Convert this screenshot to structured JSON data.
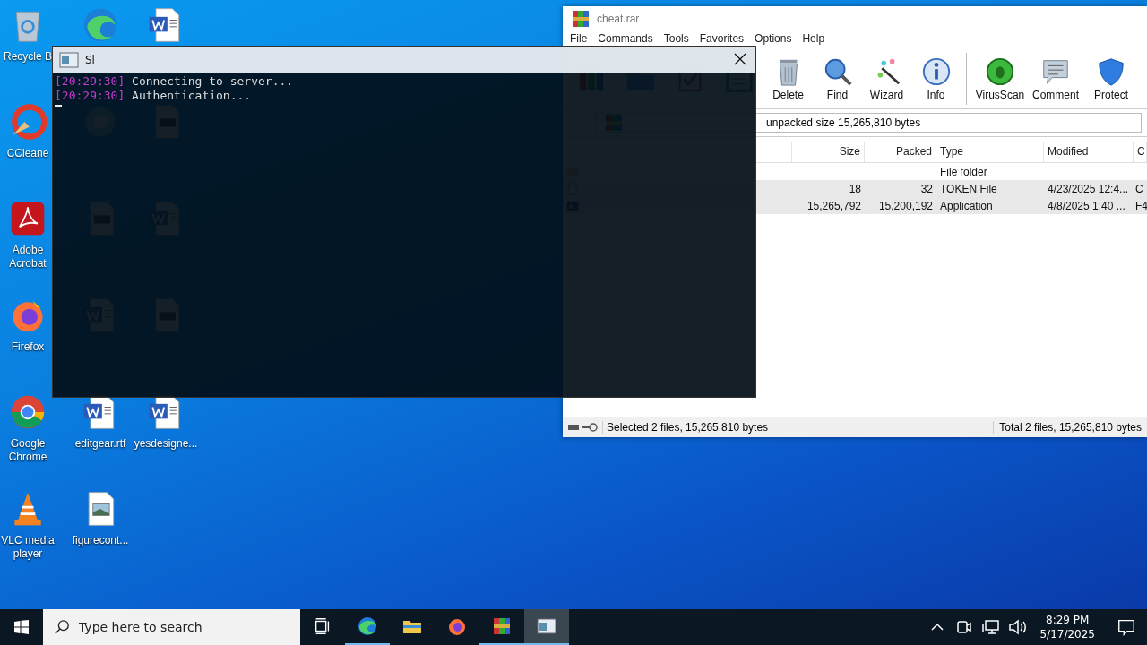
{
  "desktop": {
    "columns": [
      [
        {
          "kind": "recycle",
          "label": "Recycle B"
        },
        {
          "kind": "ccleaner",
          "label": "CCleane"
        },
        {
          "kind": "acrobat",
          "label": "Adobe Acrobat"
        },
        {
          "kind": "firefox",
          "label": "Firefox"
        },
        {
          "kind": "chrome",
          "label": "Google Chrome"
        },
        {
          "kind": "vlc",
          "label": "VLC media player"
        }
      ],
      [
        {
          "kind": "edge"
        },
        {
          "kind": "skype"
        },
        {
          "kind": "document"
        },
        {
          "kind": "word"
        },
        {
          "kind": "word",
          "label": "editgear.rtf"
        },
        {
          "kind": "image",
          "label": "figurecont..."
        }
      ],
      [
        {
          "kind": "word"
        },
        {
          "kind": "document"
        },
        {
          "kind": "word"
        },
        {
          "kind": "document"
        },
        {
          "kind": "word",
          "label": "yesdesigne..."
        }
      ]
    ]
  },
  "winrar": {
    "title": "cheat.rar",
    "menu": [
      "File",
      "Commands",
      "Tools",
      "Favorites",
      "Options",
      "Help"
    ],
    "toolbar": {
      "groups": [
        [
          {
            "kind": "add"
          },
          {
            "kind": "extract"
          },
          {
            "kind": "test"
          },
          {
            "kind": "view"
          },
          {
            "kind": "delete",
            "label": "Delete"
          },
          {
            "kind": "find",
            "label": "Find"
          },
          {
            "kind": "wizard",
            "label": "Wizard"
          },
          {
            "kind": "info",
            "label": "Info"
          }
        ],
        [
          {
            "kind": "virusscan",
            "label": "VirusScan"
          },
          {
            "kind": "comment",
            "label": "Comment"
          },
          {
            "kind": "protect",
            "label": "Protect"
          }
        ]
      ]
    },
    "address": "unpacked size 15,265,810 bytes",
    "columns": [
      "Size",
      "Packed",
      "Type",
      "Modified",
      "C"
    ],
    "files": [
      {
        "kind": "folder",
        "type": "File folder",
        "selected": false
      },
      {
        "kind": "file",
        "size": "18",
        "packed": "32",
        "type": "TOKEN File",
        "modified": "4/23/2025 12:4...",
        "column_6": "C",
        "selected": true
      },
      {
        "kind": "exe",
        "size": "15,265,792",
        "packed": "15,200,192",
        "type": "Application",
        "modified": "4/8/2025 1:40 ...",
        "column_6": "F4",
        "selected": true
      }
    ],
    "status_bar": {
      "selected": "Selected 2 files, 15,265,810 bytes",
      "total": "Total 2 files, 15,265,810 bytes"
    }
  },
  "console": {
    "title": "Sl",
    "lines": [
      {
        "time": "[20:29:30]",
        "text": "Connecting to server..."
      },
      {
        "time": "[20:29:30]",
        "text": "Authentication..."
      }
    ]
  },
  "taskbar": {
    "search": {
      "placeholder": "Type here to search"
    },
    "apps": [
      {
        "kind": "edge",
        "running": true,
        "selected": false
      },
      {
        "kind": "explorer",
        "running": false,
        "selected": false
      },
      {
        "kind": "firefox",
        "running": false,
        "selected": false
      },
      {
        "kind": "winrar",
        "running": true,
        "selected": false
      },
      {
        "kind": "console",
        "running": true,
        "selected": true
      }
    ],
    "time": "8:29 PM",
    "date": "5/17/2025"
  }
}
